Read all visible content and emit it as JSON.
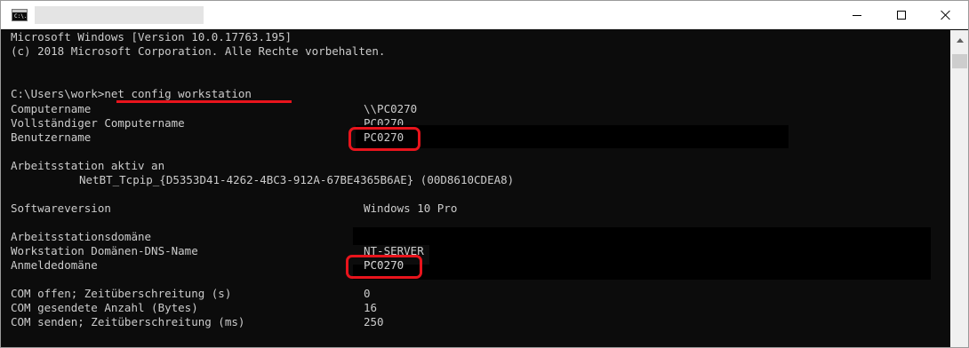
{
  "window": {
    "icon_label": "C:\\.",
    "controls": {
      "minimize": "minimize-icon",
      "maximize": "maximize-icon",
      "close": "close-icon"
    }
  },
  "console": {
    "header_lines": [
      "Microsoft Windows [Version 10.0.17763.195]",
      "(c) 2018 Microsoft Corporation. Alle Rechte vorbehalten."
    ],
    "prompt": "C:\\Users\\work>net config workstation",
    "rows": [
      {
        "label": "Computername",
        "value": "\\\\PC0270"
      },
      {
        "label": "Vollständiger Computername",
        "value": "PC0270"
      },
      {
        "label": "Benutzername",
        "value": "PC0270"
      },
      {
        "label": "Arbeitsstation aktiv an",
        "value": ""
      },
      {
        "label": "NetBT_Tcpip_{D5353D41-4262-4BC3-912A-67BE4365B6AE} (00D8610CDEA8)",
        "value": ""
      },
      {
        "label": "Softwareversion",
        "value": "Windows 10 Pro"
      },
      {
        "label": "Arbeitsstationsdomäne",
        "value": ""
      },
      {
        "label": "Workstation Domänen-DNS-Name",
        "value": "NT-SERVER"
      },
      {
        "label": "Anmeldedomäne",
        "value": "PC0270"
      },
      {
        "label": "COM offen; Zeitüberschreitung (s)",
        "value": "0"
      },
      {
        "label": "COM gesendete Anzahl (Bytes)",
        "value": "16"
      },
      {
        "label": "COM senden; Zeitüberschreitung (ms)",
        "value": "250"
      }
    ]
  },
  "colors": {
    "console_bg": "#0c0c0c",
    "console_text": "#cccccc",
    "highlight": "#e8141c",
    "titlebar_bg": "#ffffff"
  }
}
